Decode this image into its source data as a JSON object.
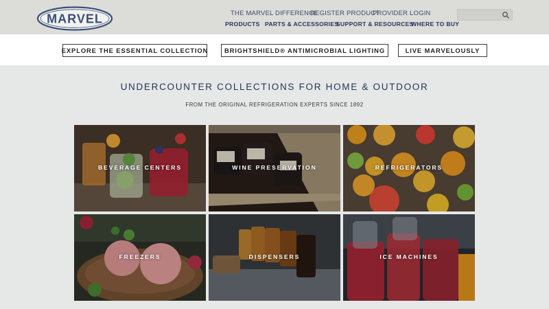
{
  "header": {
    "logo_text": "MARVEL",
    "utility_nav": [
      "THE MARVEL DIFFERENCE",
      "REGISTER PRODUCT",
      "PROVIDER LOGIN"
    ],
    "main_nav": [
      "PRODUCTS",
      "PARTS & ACCESSORIES",
      "SUPPORT & RESOURCES",
      "WHERE TO BUY"
    ],
    "search": {
      "placeholder": "",
      "icon": "search-icon"
    }
  },
  "promo": {
    "buttons": [
      "EXPLORE THE ESSENTIAL COLLECTION",
      "BRIGHTSHIELD® ANTIMICROBIAL LIGHTING",
      "LIVE MARVELOUSLY"
    ]
  },
  "collections": {
    "title": "UNDERCOUNTER COLLECTIONS FOR HOME & OUTDOOR",
    "subtitle": "FROM THE ORIGINAL REFRIGERATION EXPERTS SINCE 1892",
    "tiles": [
      {
        "label": "BEVERAGE CENTERS"
      },
      {
        "label": "WINE PRESERVATION"
      },
      {
        "label": "REFRIGERATORS"
      },
      {
        "label": "FREEZERS"
      },
      {
        "label": "DISPENSERS"
      },
      {
        "label": "ICE MACHINES"
      }
    ]
  },
  "colors": {
    "brand_navy": "#25355a",
    "header_bg": "#dcdcd9",
    "page_bg": "#e6e8e7"
  }
}
